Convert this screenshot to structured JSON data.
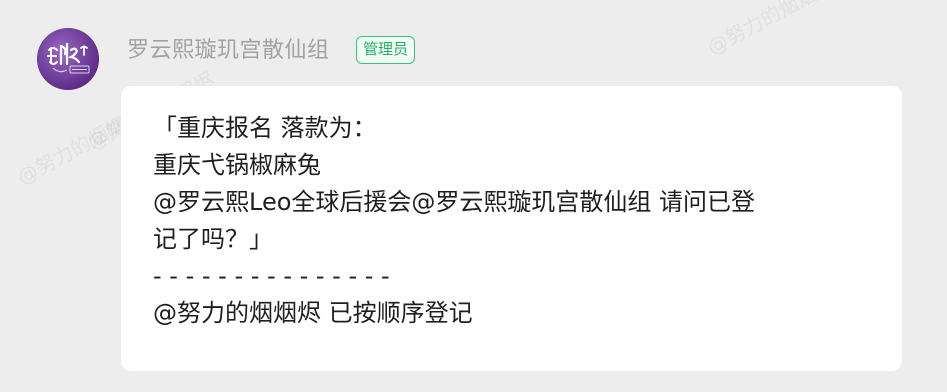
{
  "sender": {
    "name": "罗云熙璇玑宫散仙组",
    "role_badge": "管理员",
    "avatar_label": "韵山宫 璇玑宫"
  },
  "message": {
    "lines": [
      "「重庆报名 落款为：",
      "重庆弋锅椒麻兔",
      "@罗云熙Leo全球后援会@罗云熙璇玑宫散仙组 请问已登",
      "记了吗？」",
      "- - - - - - - - - - - - - - -",
      "@努力的烟烟烬 已按顺序登记"
    ]
  },
  "watermark": {
    "text": "@努力的烟烟烬"
  },
  "colors": {
    "background": "#ededed",
    "bubble": "#ffffff",
    "badge_accent": "#25b06a",
    "avatar": "#6a3898",
    "name": "#a2a2a2"
  }
}
